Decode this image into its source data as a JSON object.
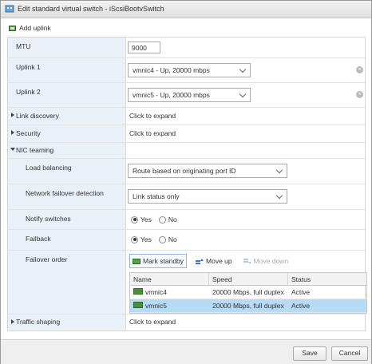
{
  "window": {
    "title": "Edit standard virtual switch - iScsiBootvSwitch"
  },
  "toolbar": {
    "add_uplink": "Add uplink"
  },
  "fields": {
    "mtu": {
      "label": "MTU",
      "value": "9000"
    },
    "uplink1": {
      "label": "Uplink 1",
      "value": "vmnic4 - Up, 20000 mbps"
    },
    "uplink2": {
      "label": "Uplink 2",
      "value": "vmnic5 - Up, 20000 mbps"
    },
    "link_discovery": {
      "label": "Link discovery",
      "value": "Click to expand"
    },
    "security": {
      "label": "Security",
      "value": "Click to expand"
    },
    "nic_teaming": {
      "label": "NIC teaming"
    },
    "load_balancing": {
      "label": "Load balancing",
      "value": "Route based on originating port ID"
    },
    "failover_detection": {
      "label": "Network failover detection",
      "value": "Link status only"
    },
    "notify_switches": {
      "label": "Notify switches",
      "yes": "Yes",
      "no": "No",
      "selected": "Yes"
    },
    "failback": {
      "label": "Failback",
      "yes": "Yes",
      "no": "No",
      "selected": "Yes"
    },
    "failover_order": {
      "label": "Failover order",
      "buttons": {
        "mark_standby": "Mark standby",
        "move_up": "Move up",
        "move_down": "Move down"
      },
      "columns": [
        "Name",
        "Speed",
        "Status"
      ],
      "rows": [
        {
          "name": "vmnic4",
          "speed": "20000 Mbps, full duplex",
          "status": "Active",
          "selected": false
        },
        {
          "name": "vmnic5",
          "speed": "20000 Mbps, full duplex",
          "status": "Active",
          "selected": true
        }
      ]
    },
    "traffic_shaping": {
      "label": "Traffic shaping",
      "value": "Click to expand"
    }
  },
  "footer": {
    "save": "Save",
    "cancel": "Cancel"
  },
  "colors": {
    "label_bg": "#e9f0f8",
    "selected_row": "#b7daf5",
    "accent": "#2d6a23"
  }
}
